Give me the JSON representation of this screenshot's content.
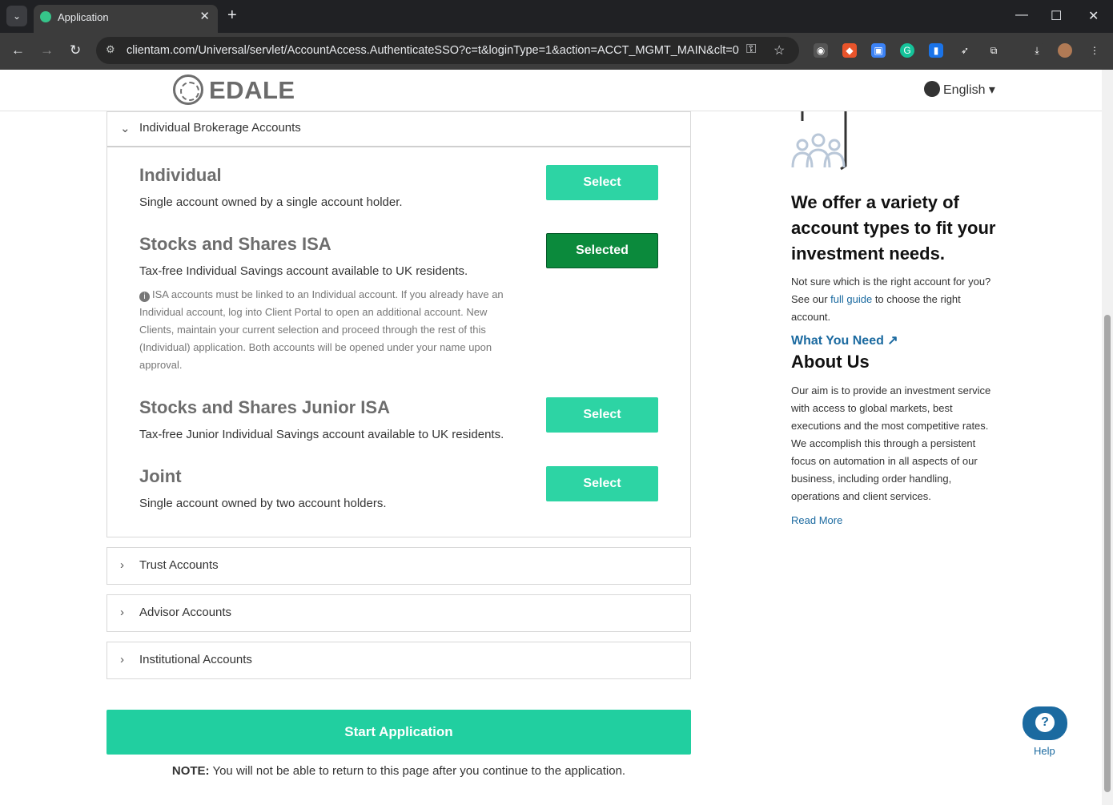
{
  "browser": {
    "tab_title": "Application",
    "tab_close": "✕",
    "new_tab": "+",
    "url": "clientam.com/Universal/servlet/AccountAccess.AuthenticateSSO?c=t&loginType=1&action=ACCT_MGMT_MAIN&clt=0",
    "controls": {
      "minimize": "—",
      "maximize": "☐",
      "close": "✕"
    },
    "nav": {
      "back": "←",
      "forward": "→",
      "reload": "↻"
    }
  },
  "header": {
    "logo_text": "EDALE",
    "language": "English ▾"
  },
  "sections": {
    "open": {
      "label": "Individual Brokerage Accounts",
      "chevron": "⌄",
      "accounts": [
        {
          "title": "Individual",
          "description": "Single account owned by a single account holder.",
          "button": "Select",
          "selected": false
        },
        {
          "title": "Stocks and Shares ISA",
          "description": "Tax-free Individual Savings account available to UK residents.",
          "button": "Selected",
          "selected": true,
          "note": "ISA accounts must be linked to an Individual account. If you already have an Individual account, log into Client Portal to open an additional account. New Clients, maintain your current selection and proceed through the rest of this (Individual) application. Both accounts will be opened under your name upon approval."
        },
        {
          "title": "Stocks and Shares Junior ISA",
          "description": "Tax-free Junior Individual Savings account available to UK residents.",
          "button": "Select",
          "selected": false
        },
        {
          "title": "Joint",
          "description": "Single account owned by two account holders.",
          "button": "Select",
          "selected": false
        }
      ]
    },
    "collapsed": [
      {
        "label": "Trust Accounts"
      },
      {
        "label": "Advisor Accounts"
      },
      {
        "label": "Institutional Accounts"
      }
    ],
    "collapsed_chevron": "›"
  },
  "start_button": "Start Application",
  "note": {
    "bold": "NOTE:",
    "text": " You will not be able to return to this page after you continue to the application."
  },
  "sidebar": {
    "heading": "We offer a variety of account types to fit your investment needs.",
    "text_before": "Not sure which is the right account for you? See our ",
    "link": "full guide",
    "text_after": " to choose the right account.",
    "what_you_need": "What You Need ↗",
    "about_title": "About Us",
    "about_text": "Our aim is to provide an investment service with access to global markets, best executions and the most competitive rates. We accomplish this through a persistent focus on automation in all aspects of our business, including order handling, operations and client services.",
    "read_more": "Read More"
  },
  "help": {
    "icon": "?",
    "label": "Help"
  },
  "colors": {
    "accent": "#2dd4a4",
    "selected": "#0b8a3c",
    "link": "#1b6aa0"
  }
}
